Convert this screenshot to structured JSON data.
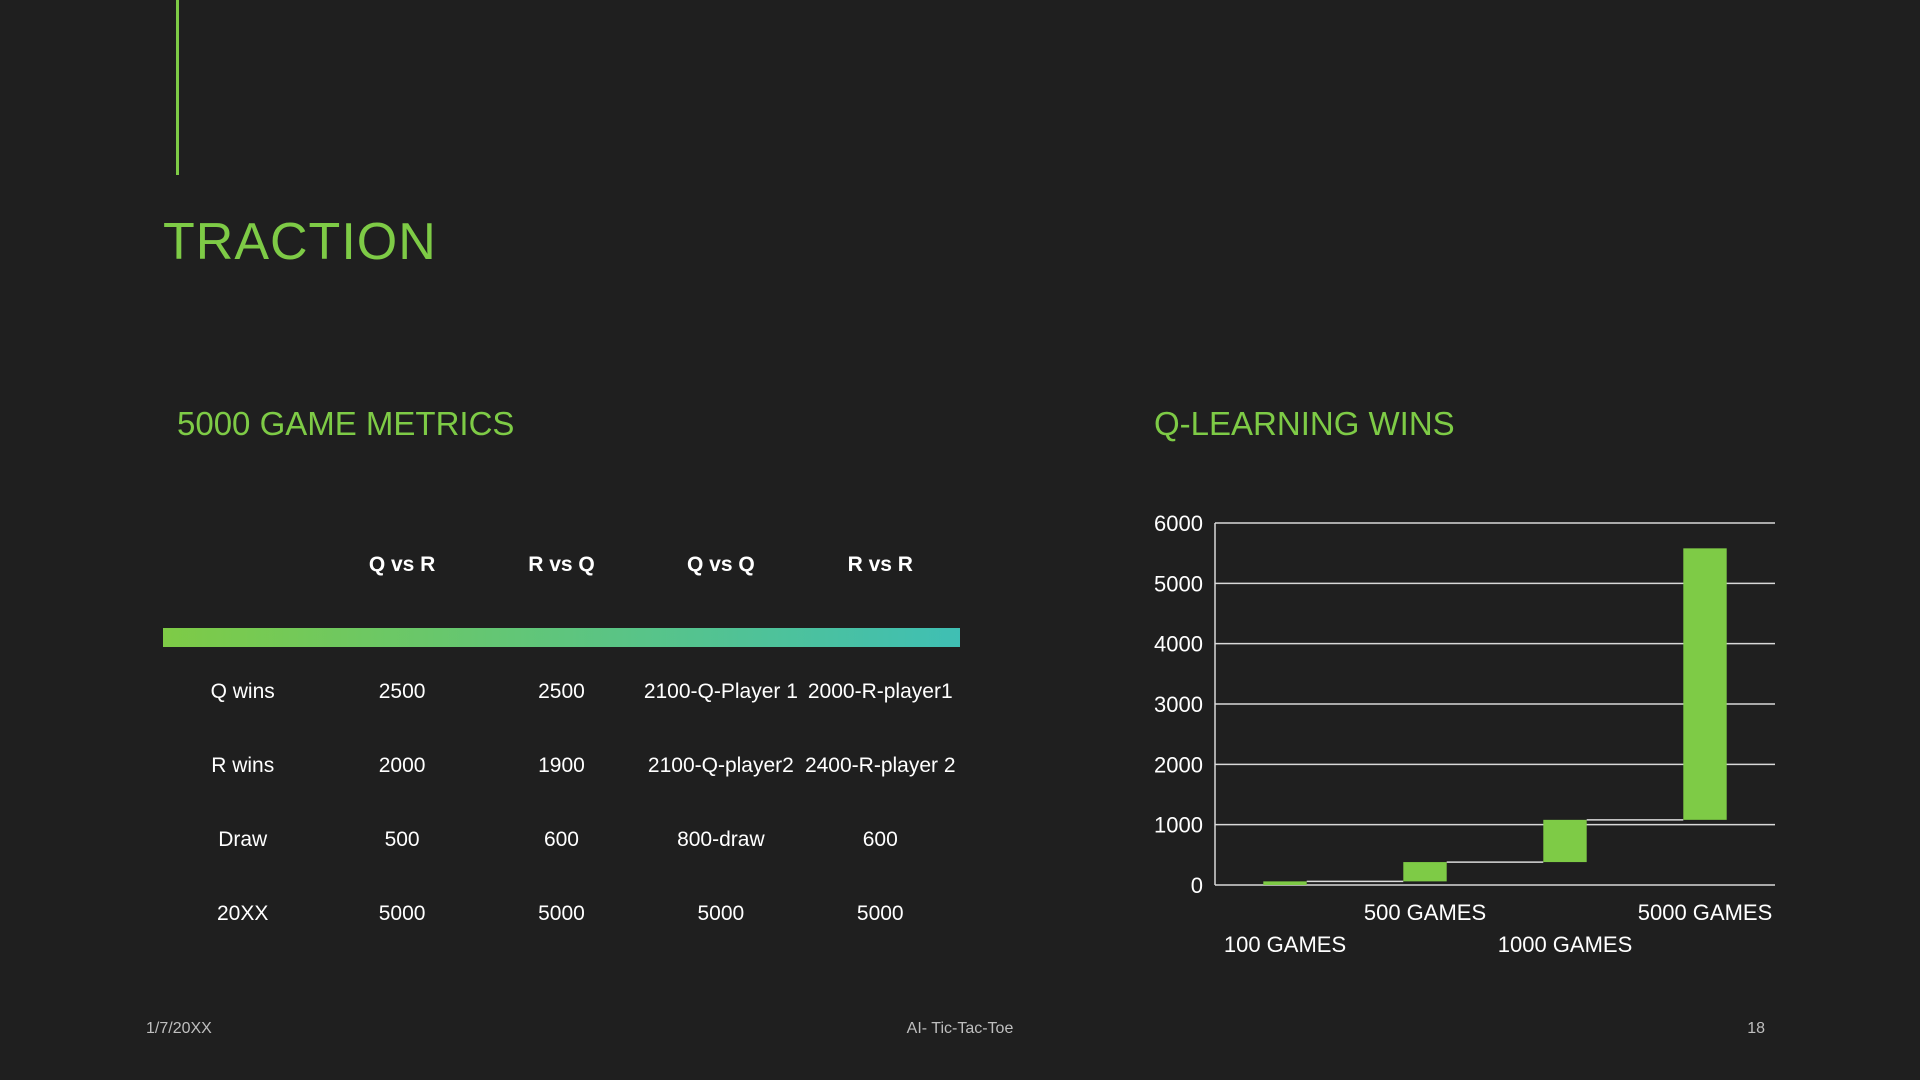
{
  "slide": {
    "title": "TRACTION",
    "left_heading": "5000 GAME METRICS",
    "right_heading": "Q-LEARNING WINS",
    "footer_date": "1/7/20XX",
    "footer_center": "AI- Tic-Tac-Toe",
    "page_number": "18",
    "accent_color": "#7ecb46",
    "gradient_end_color": "#3fbfb4"
  },
  "table": {
    "headers": [
      "",
      "Q vs R",
      "R vs Q",
      "Q vs Q",
      "R vs R"
    ],
    "rows": [
      [
        "Q wins",
        "2500",
        "2500",
        "2100-Q-Player 1",
        "2000-R-player1"
      ],
      [
        "R wins",
        "2000",
        "1900",
        "2100-Q-player2",
        "2400-R-player 2"
      ],
      [
        "Draw",
        "500",
        "600",
        "800-draw",
        "600"
      ],
      [
        "20XX",
        "5000",
        "5000",
        "5000",
        "5000"
      ]
    ]
  },
  "chart_data": {
    "type": "bar",
    "subtype": "waterfall",
    "categories": [
      "100 GAMES",
      "500 GAMES",
      "1000 GAMES",
      "5000 GAMES"
    ],
    "values": [
      60,
      320,
      700,
      4500
    ],
    "cumulative": [
      60,
      380,
      1080,
      5580
    ],
    "ylim": [
      0,
      6000
    ],
    "yticks": [
      0,
      1000,
      2000,
      3000,
      4000,
      5000,
      6000
    ],
    "grid": true,
    "bar_color": "#7ecb46"
  }
}
